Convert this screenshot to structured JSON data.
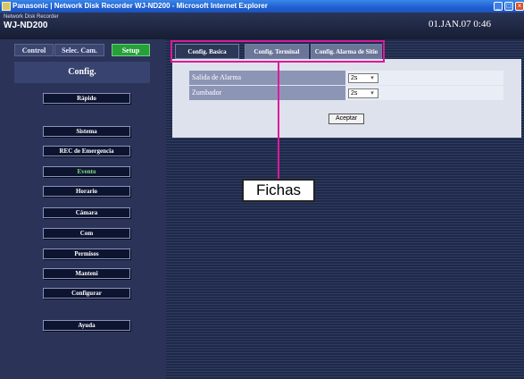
{
  "window": {
    "title": "Panasonic  |  Network Disk Recorder WJ-ND200 - Microsoft Internet Explorer",
    "min_label": "_",
    "max_label": "□",
    "close_label": "×"
  },
  "header": {
    "brand_small": "Network Disk Recorder",
    "model": "WJ-ND200",
    "datetime": "01.JAN.07  0:46"
  },
  "nav_tabs": {
    "control": "Control",
    "selec": "Selec. Cam.",
    "setup": "Setup"
  },
  "config_title": "Config.",
  "menu": [
    {
      "label": "Rápido",
      "active": false
    },
    {
      "label": "Sistema",
      "active": false
    },
    {
      "label": "REC de Emergencia",
      "active": false
    },
    {
      "label": "Evento",
      "active": true
    },
    {
      "label": "Horario",
      "active": false
    },
    {
      "label": "Cámara",
      "active": false
    },
    {
      "label": "Com",
      "active": false
    },
    {
      "label": "Permisos",
      "active": false
    },
    {
      "label": "Manteni",
      "active": false
    },
    {
      "label": "Configurar",
      "active": false
    },
    {
      "label": "Ayuda",
      "active": false
    }
  ],
  "config_tabs": {
    "basica": "Config. Basica",
    "terminal": "Config. Terminal",
    "alarma": "Config. Alarma de Sitio"
  },
  "settings": [
    {
      "label": "Salida de Alarma",
      "value": "2s"
    },
    {
      "label": "Zumbador",
      "value": "2s"
    }
  ],
  "accept_label": "Aceptar",
  "select_arrow": "▾",
  "callout": {
    "label": "Fichas",
    "color": "#e0189a"
  }
}
